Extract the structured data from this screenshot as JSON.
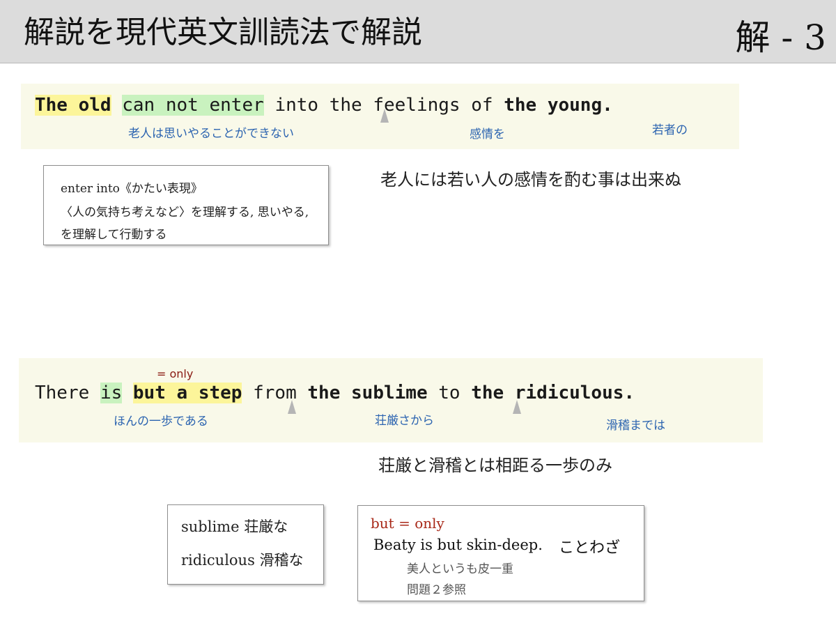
{
  "header": {
    "title": "解説を現代英文訓読法で解説",
    "page_label": "解 - 3"
  },
  "sentence1": {
    "words": [
      "The",
      "old",
      "can",
      "not",
      "enter",
      "into",
      "the",
      "feelings",
      "of",
      "the",
      "young."
    ],
    "glosses": {
      "g1": "老人は思いやることができない",
      "g2": "感情を",
      "g3": "若者の"
    },
    "translation": "老人には若い人の感情を酌む事は出来ぬ"
  },
  "vocab1": {
    "line1": "enter into《かたい表現》",
    "line2": "〈人の気持ち考えなど〉を理解する, 思いやる,",
    "line3": "を理解して行動する"
  },
  "sentence2": {
    "note": "= only",
    "words": [
      "There",
      "is",
      "but",
      "a",
      "step",
      "from",
      "the",
      "sublime",
      "to",
      "the",
      "ridiculous."
    ],
    "glosses": {
      "g1": "ほんの一歩である",
      "g2": "荘厳さから",
      "g3": "滑稽までは"
    },
    "translation": "荘厳と滑稽とは相距る一歩のみ"
  },
  "vocab2": {
    "line1": "sublime 荘厳な",
    "line2": "ridiculous 滑稽な"
  },
  "example": {
    "head": "but = only",
    "sentence": "Beaty is but skin-deep.",
    "tag": "ことわざ",
    "meaning": "美人というも皮一重",
    "ref": "問題２参照"
  },
  "colors": {
    "highlight_yellow": "#fcf59a",
    "highlight_green": "#c9f2bf",
    "gloss_blue": "#2c64b0",
    "note_red": "#8a1a12"
  }
}
